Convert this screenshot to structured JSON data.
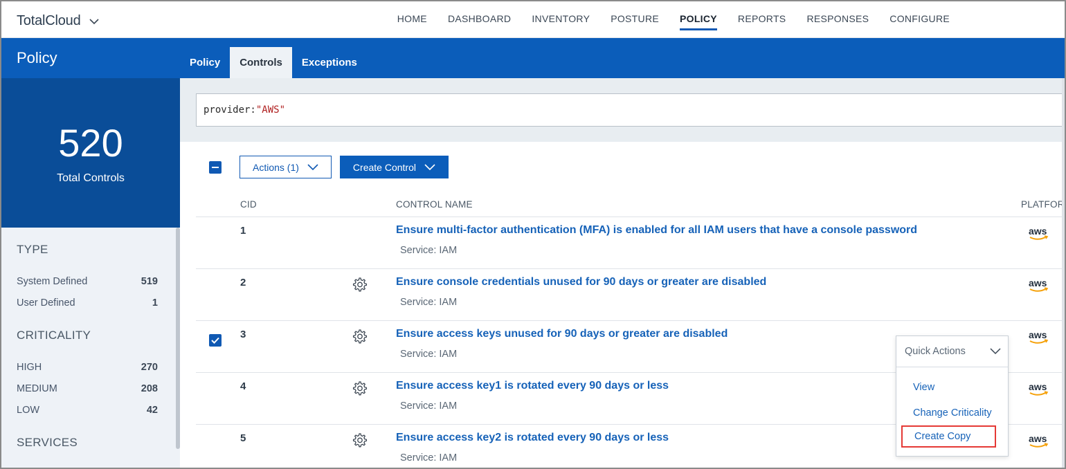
{
  "app": {
    "brand": "TotalCloud",
    "nav": [
      {
        "label": "HOME"
      },
      {
        "label": "DASHBOARD"
      },
      {
        "label": "INVENTORY"
      },
      {
        "label": "POSTURE"
      },
      {
        "label": "POLICY",
        "active": true
      },
      {
        "label": "REPORTS"
      },
      {
        "label": "RESPONSES"
      },
      {
        "label": "CONFIGURE"
      }
    ]
  },
  "module": {
    "title": "Policy",
    "tabs": [
      {
        "label": "Policy"
      },
      {
        "label": "Controls",
        "active": true
      },
      {
        "label": "Exceptions"
      }
    ]
  },
  "summary": {
    "count": "520",
    "label": "Total Controls"
  },
  "facets": {
    "type": {
      "heading": "TYPE",
      "items": [
        {
          "label": "System Defined",
          "count": "519"
        },
        {
          "label": "User Defined",
          "count": "1"
        }
      ]
    },
    "criticality": {
      "heading": "CRITICALITY",
      "items": [
        {
          "label": "HIGH",
          "count": "270"
        },
        {
          "label": "MEDIUM",
          "count": "208"
        },
        {
          "label": "LOW",
          "count": "42"
        }
      ]
    },
    "services": {
      "heading": "SERVICES"
    }
  },
  "search": {
    "key": "provider:",
    "value": "\"AWS\""
  },
  "toolbar": {
    "actions_label": "Actions (1)",
    "create_label": "Create Control"
  },
  "table": {
    "columns": {
      "cid": "CID",
      "name": "CONTROL NAME",
      "platform": "PLATFORM"
    },
    "rows": [
      {
        "cid": "1",
        "name": "Ensure multi-factor authentication (MFA) is enabled for all IAM users that have a console password",
        "service": "Service: IAM",
        "platform": "aws",
        "gear": false,
        "checked": false
      },
      {
        "cid": "2",
        "name": "Ensure console credentials unused for 90 days or greater are disabled",
        "service": "Service: IAM",
        "platform": "aws",
        "gear": true,
        "checked": false
      },
      {
        "cid": "3",
        "name": "Ensure access keys unused for 90 days or greater are disabled",
        "service": "Service: IAM",
        "platform": "aws",
        "gear": true,
        "checked": true
      },
      {
        "cid": "4",
        "name": "Ensure access key1 is rotated every 90 days or less",
        "service": "Service: IAM",
        "platform": "aws",
        "gear": true,
        "checked": false
      },
      {
        "cid": "5",
        "name": "Ensure access key2 is rotated every 90 days or less",
        "service": "Service: IAM",
        "platform": "aws",
        "gear": true,
        "checked": false
      }
    ]
  },
  "quick_actions": {
    "label": "Quick Actions",
    "items": [
      {
        "label": "View"
      },
      {
        "label": "Change Criticality"
      },
      {
        "label": "Create Copy",
        "highlighted": true
      }
    ]
  },
  "colors": {
    "brand_blue": "#0b5dba",
    "dark_blue": "#0a4d98",
    "link_blue": "#1662b8",
    "highlight_red": "#e53935"
  }
}
